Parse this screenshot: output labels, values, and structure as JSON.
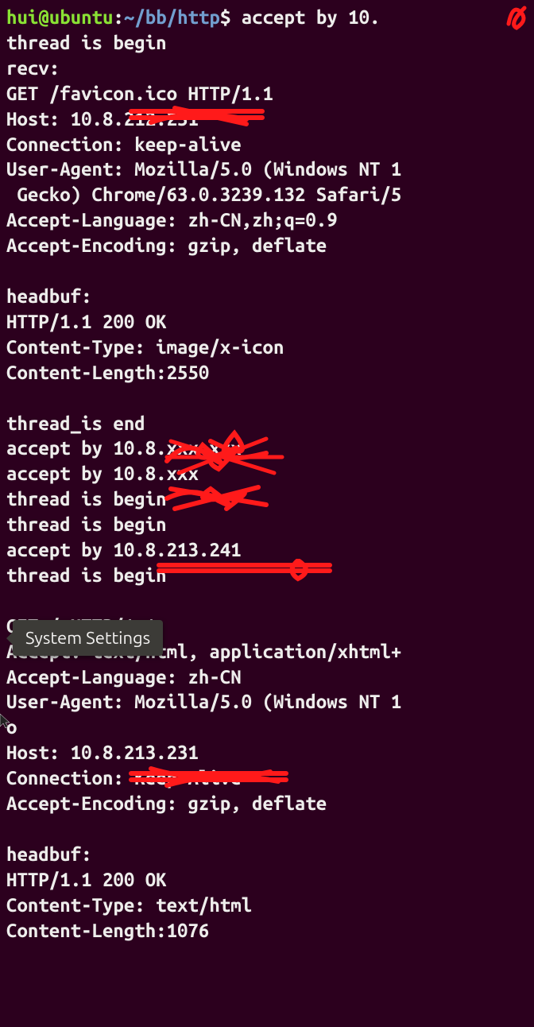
{
  "prompt": {
    "user": "hui",
    "host": "ubuntu",
    "path": "~/bb/http",
    "command": "accept by 10."
  },
  "lines": {
    "l1": "thread is begin",
    "l2": "recv:",
    "l3": "GET /favicon.ico HTTP/1.1",
    "l4": "Host: 10.8.212.231",
    "l5": "Connection: keep-alive",
    "l6": "User-Agent: Mozilla/5.0 (Windows NT 1",
    "l7": " Gecko) Chrome/63.0.3239.132 Safari/5",
    "l8": "Accept-Language: zh-CN,zh;q=0.9",
    "l9": "Accept-Encoding: gzip, deflate",
    "l10": "",
    "l11": "headbuf:",
    "l12": "HTTP/1.1 200 OK",
    "l13": "Content-Type: image/x-icon",
    "l14": "Content-Length:2550",
    "l15": "",
    "l16": "thread_is end",
    "l17": "accept by 10.8.xxx.xxx",
    "l18": "accept by 10.8.xxx",
    "l19": "thread is begin",
    "l20": "thread is begin",
    "l21": "accept by 10.8.213.241",
    "l22": "thread is begin",
    "l23": "",
    "l24": "GET / HTTP/1.1",
    "l25": "Accept: text/html, application/xhtml+",
    "l26": "Accept-Language: zh-CN",
    "l27": "User-Agent: Mozilla/5.0 (Windows NT 1",
    "l28": "o",
    "l29": "Host: 10.8.213.231",
    "l30": "Connection: Keep-Alive",
    "l31": "Accept-Encoding: gzip, deflate",
    "l32": "",
    "l33": "headbuf:",
    "l34": "HTTP/1.1 200 OK",
    "l35": "Content-Type: text/html",
    "l36": "Content-Length:1076"
  },
  "tooltip": {
    "label": "System Settings"
  }
}
